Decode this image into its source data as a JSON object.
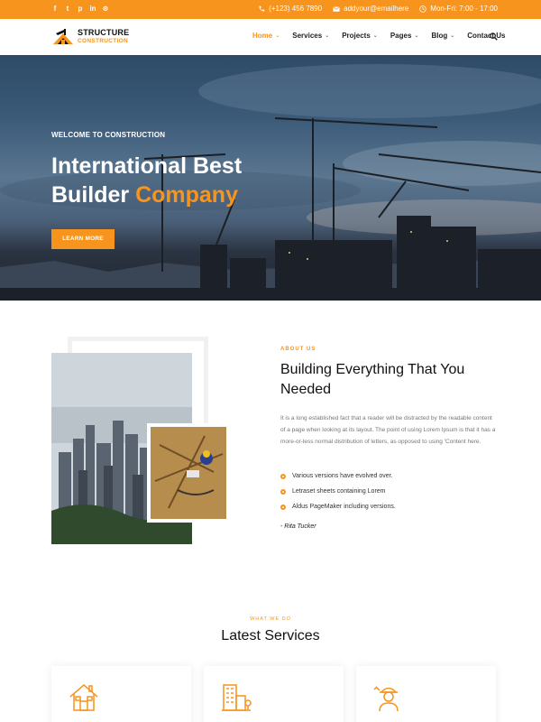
{
  "topbar": {
    "socials": [
      {
        "name": "facebook-icon",
        "glyph": "f"
      },
      {
        "name": "twitter-icon",
        "glyph": "t"
      },
      {
        "name": "pinterest-icon",
        "glyph": "p"
      },
      {
        "name": "linkedin-icon",
        "glyph": "in"
      },
      {
        "name": "dribbble-icon",
        "glyph": "⊛"
      }
    ],
    "phone": "(+123) 456 7890",
    "email": "addyour@emailhere",
    "hours": "Mon-Fri: 7:00 - 17:00"
  },
  "brand": {
    "name": "STRUCTURE",
    "tagline": "CONSTRUCTION"
  },
  "nav": {
    "items": [
      {
        "label": "Home",
        "caret": "⌄",
        "active": true
      },
      {
        "label": "Services",
        "caret": "⌄"
      },
      {
        "label": "Projects",
        "caret": "⌄"
      },
      {
        "label": "Pages",
        "caret": "⌄"
      },
      {
        "label": "Blog",
        "caret": "⌄"
      },
      {
        "label": "Contact Us"
      }
    ]
  },
  "hero": {
    "kicker": "WELCOME TO CONSTRUCTION",
    "title_line1": "International Best",
    "title_line2_plain": "Builder ",
    "title_line2_accent": "Company",
    "button": "LEARN MORE"
  },
  "about": {
    "kicker": "ABOUT US",
    "title": "Building Everything That You Needed",
    "paragraph": "It is a long established fact that a reader will be distracted by the readable content of a page when looking at its layout. The point of using Lorem Ipsum is that it has a more-or-less normal distribution of letters, as opposed to using 'Content here.",
    "list": [
      "Various versions have evolved over.",
      "Letraset sheets containing Lorem",
      "Aldus PageMaker including versions."
    ],
    "signature": "- Rita Tucker"
  },
  "services": {
    "kicker": "WHAT WE DO",
    "title": "Latest Services",
    "cards": [
      {
        "icon": "house-icon"
      },
      {
        "icon": "buildings-icon"
      },
      {
        "icon": "worker-icon"
      }
    ]
  },
  "colors": {
    "accent": "#f7941d"
  }
}
